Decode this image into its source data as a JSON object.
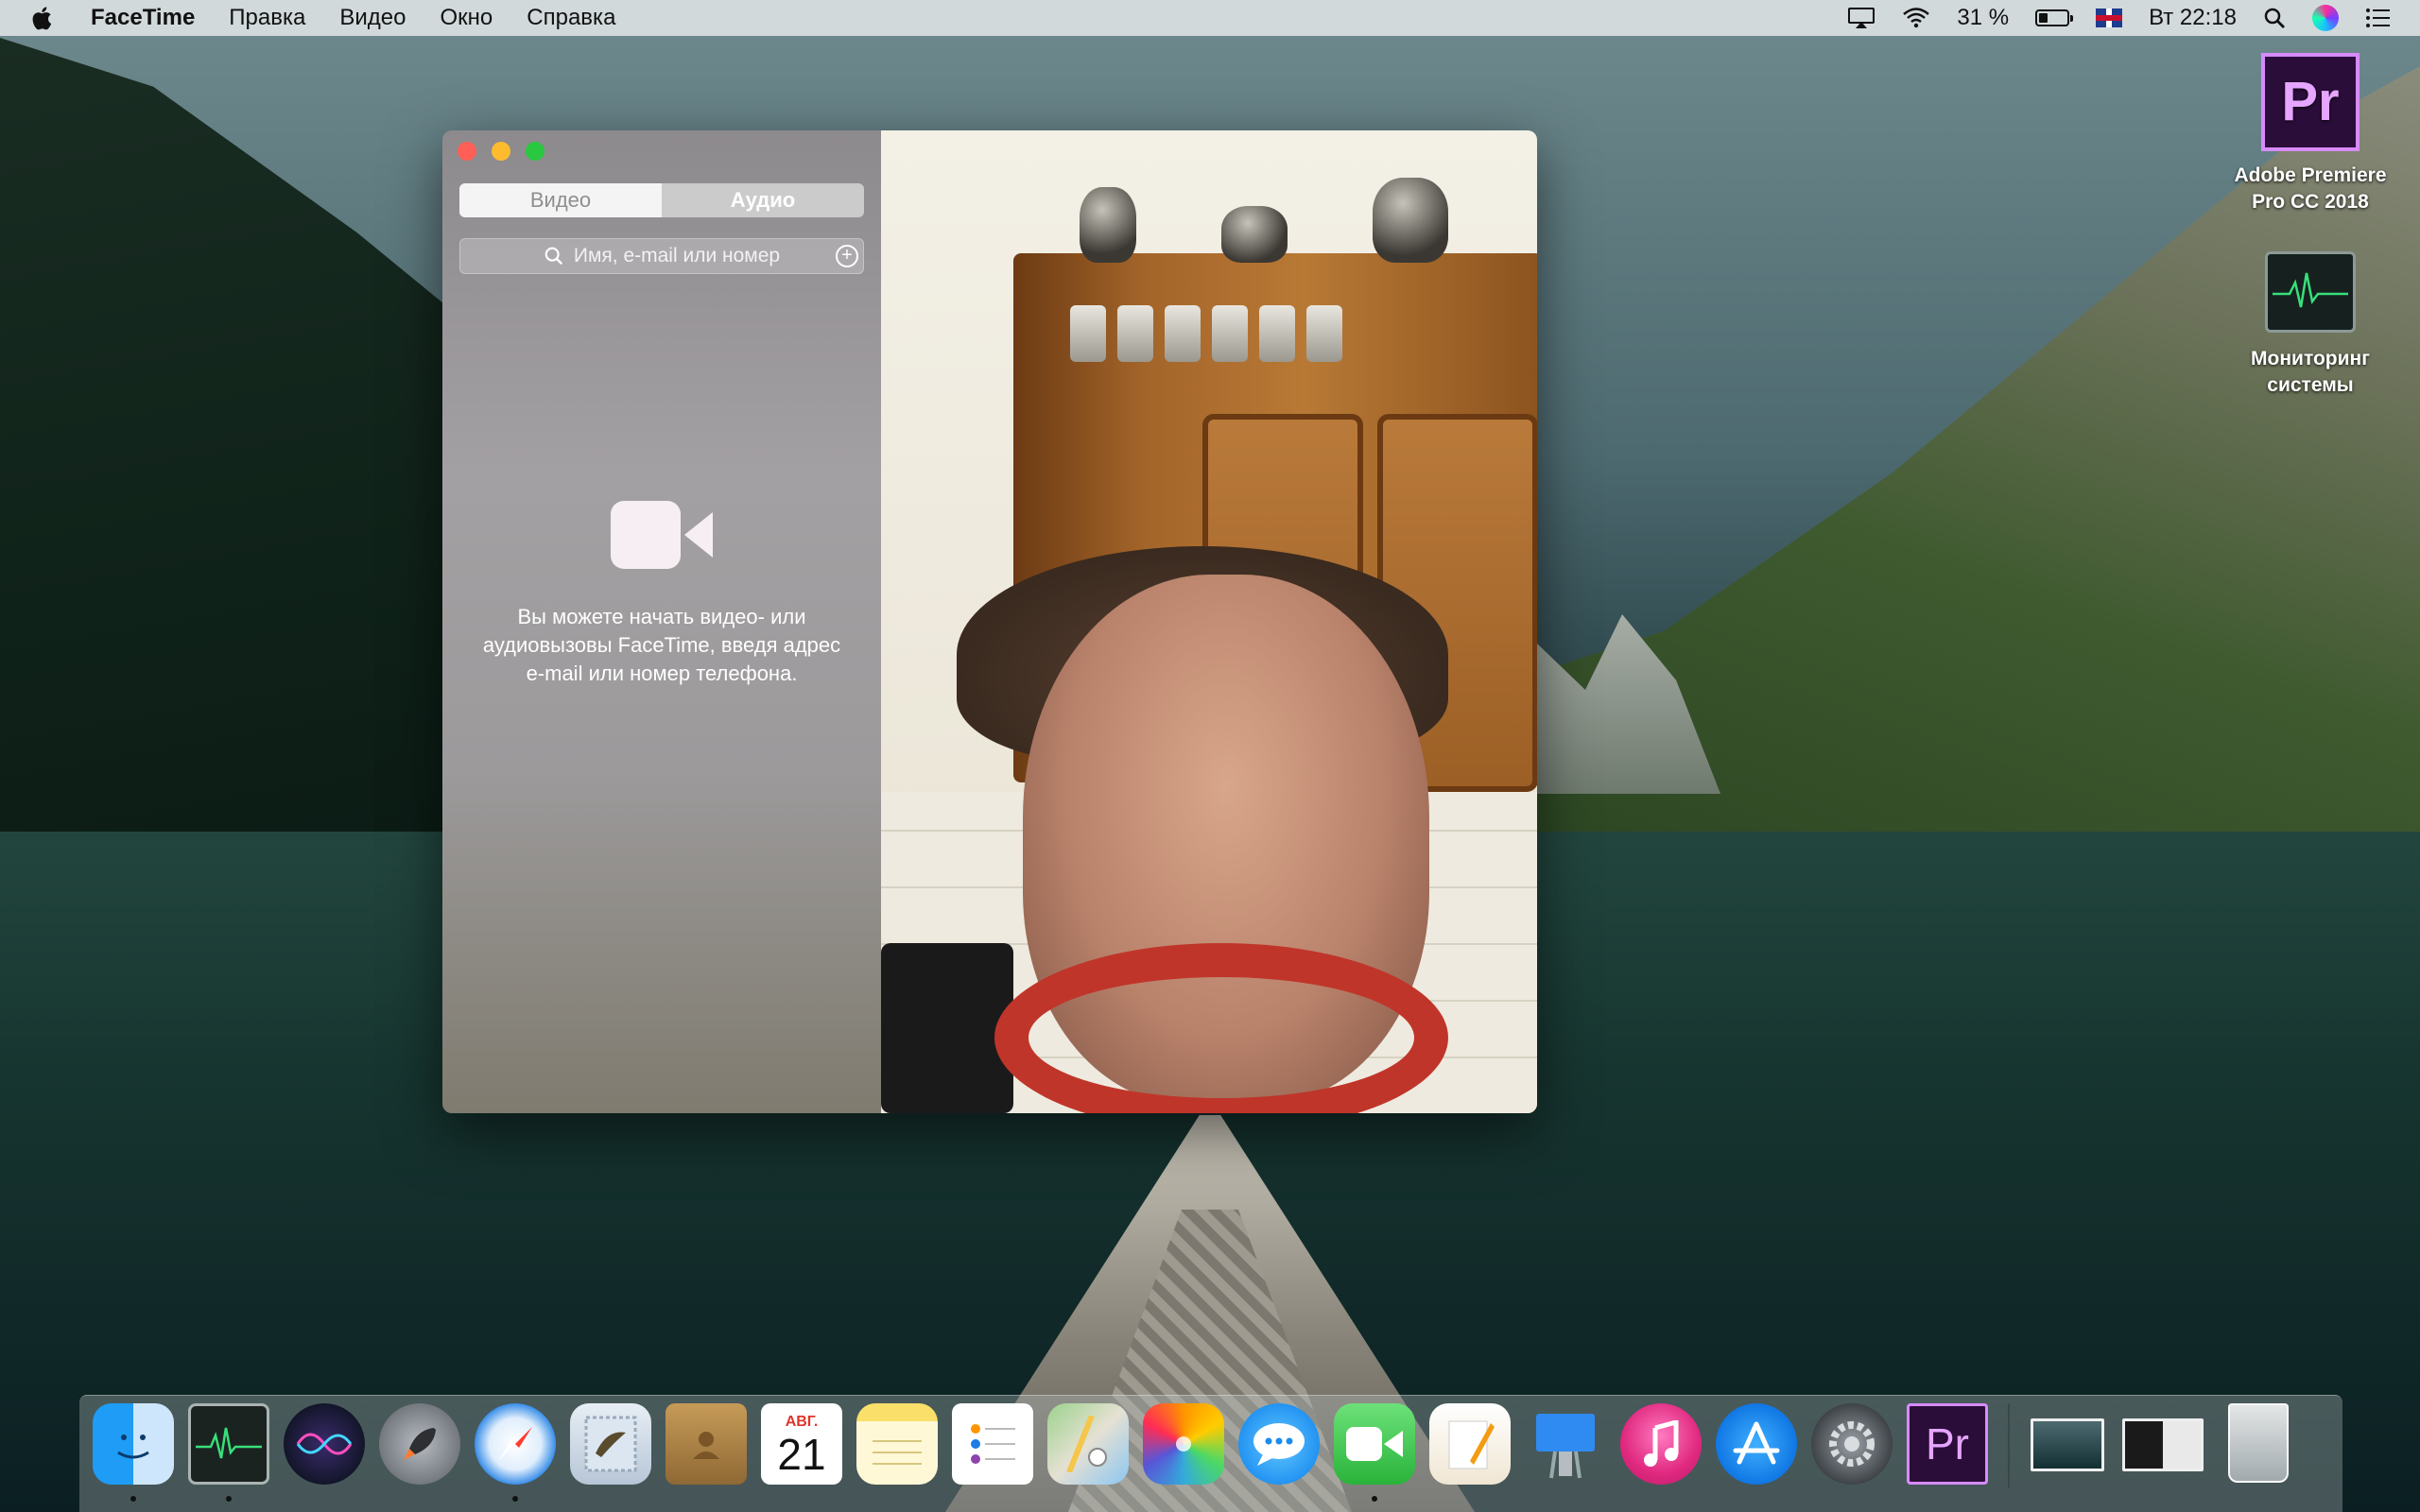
{
  "menubar": {
    "app_name": "FaceTime",
    "menus": [
      "Правка",
      "Видео",
      "Окно",
      "Справка"
    ],
    "battery_percent": "31 %",
    "battery_level": 0.31,
    "clock": "Вт 22:18",
    "icons": [
      "apple-icon",
      "airplay-icon",
      "wifi-icon",
      "battery-icon",
      "input-source-flag-icon",
      "search-icon",
      "siri-icon",
      "notification-center-icon"
    ]
  },
  "desktop_icons": [
    {
      "name": "premiere",
      "label": "Adobe Premiere Pro CC 2018",
      "glyph": "Pr"
    },
    {
      "name": "activity-monitor",
      "label": "Мониторинг системы"
    }
  ],
  "facetime": {
    "tabs": {
      "video": "Видео",
      "audio": "Аудио",
      "selected": "audio"
    },
    "search_placeholder": "Имя, e-mail или номер",
    "empty_message": "Вы можете начать видео- или аудиовызовы FaceTime, введя адрес e-mail или номер телефона."
  },
  "dock": {
    "calendar_month": "АВГ.",
    "calendar_day": "21",
    "premiere_glyph": "Pr",
    "items": [
      "Finder",
      "Мониторинг системы",
      "Siri",
      "Launchpad",
      "Safari",
      "Mail",
      "Контакты",
      "Календарь",
      "Заметки",
      "Напоминания",
      "Карты",
      "Фото",
      "Сообщения",
      "FaceTime",
      "Pages",
      "Keynote",
      "iTunes",
      "App Store",
      "Системные настройки",
      "Adobe Premiere Pro CC 2018",
      "Загрузки",
      "Документы",
      "Корзина"
    ]
  }
}
